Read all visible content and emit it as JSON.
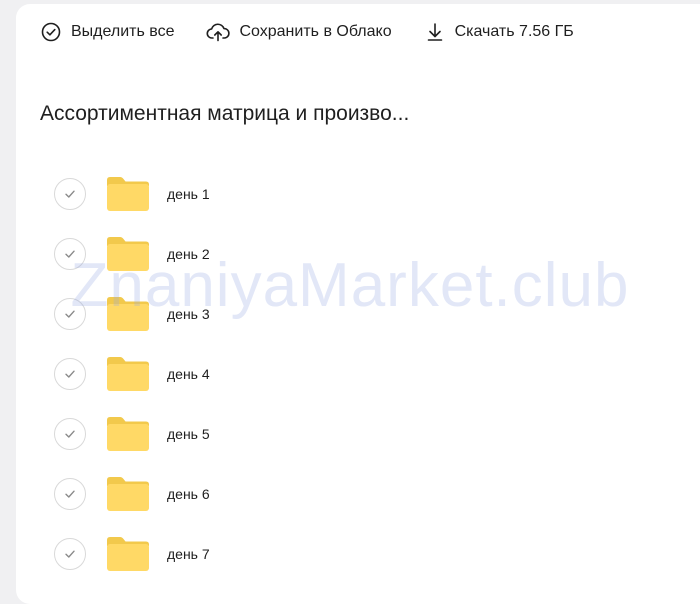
{
  "toolbar": {
    "select_all_label": "Выделить все",
    "save_to_cloud_label": "Сохранить в Облако",
    "download_label": "Скачать 7.56 ГБ"
  },
  "folder_title": "Ассортиментная матрица и произво...",
  "items": [
    {
      "label": "день 1"
    },
    {
      "label": "день 2"
    },
    {
      "label": "день 3"
    },
    {
      "label": "день 4"
    },
    {
      "label": "день 5"
    },
    {
      "label": "день 6"
    },
    {
      "label": "день 7"
    }
  ],
  "watermark": "ZnaniyaMarket.club",
  "colors": {
    "folder": "#ffd966",
    "folder_tab": "#f2c94c",
    "check": "#8a8a8a",
    "background": "#f0f0f2"
  },
  "icons": {
    "select_all": "check-circle-icon",
    "save_to_cloud": "cloud-upload-icon",
    "download": "download-icon",
    "folder": "folder-icon",
    "checkbox": "check-icon"
  }
}
